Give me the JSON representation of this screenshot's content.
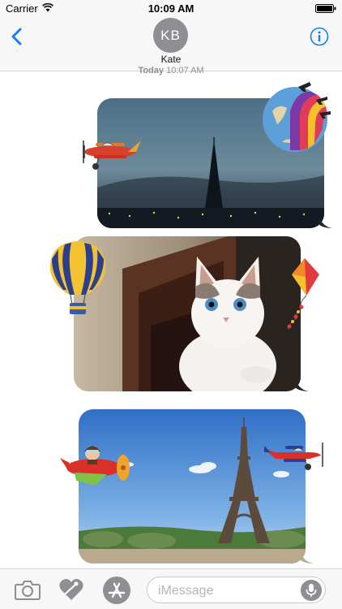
{
  "status_bar": {
    "carrier": "Carrier",
    "time": "10:09 AM"
  },
  "header": {
    "avatar_initials": "KB",
    "contact_name": "Kate"
  },
  "conversation": {
    "timestamp_day": "Today",
    "timestamp_time": "10:07 AM",
    "messages": [
      {
        "type": "image",
        "subject": "eiffel-tower-dusk"
      },
      {
        "type": "image",
        "subject": "white-kitten"
      },
      {
        "type": "image",
        "subject": "eiffel-tower-day"
      }
    ],
    "stickers": [
      "airplane",
      "rainbow-globe",
      "hot-air-balloon",
      "kite",
      "pilot-airplane",
      "airplane"
    ]
  },
  "input_bar": {
    "placeholder": "iMessage"
  },
  "colors": {
    "accent": "#147efb",
    "avatar": "#8e8e93",
    "bar_bg": "#f7f7f8"
  }
}
